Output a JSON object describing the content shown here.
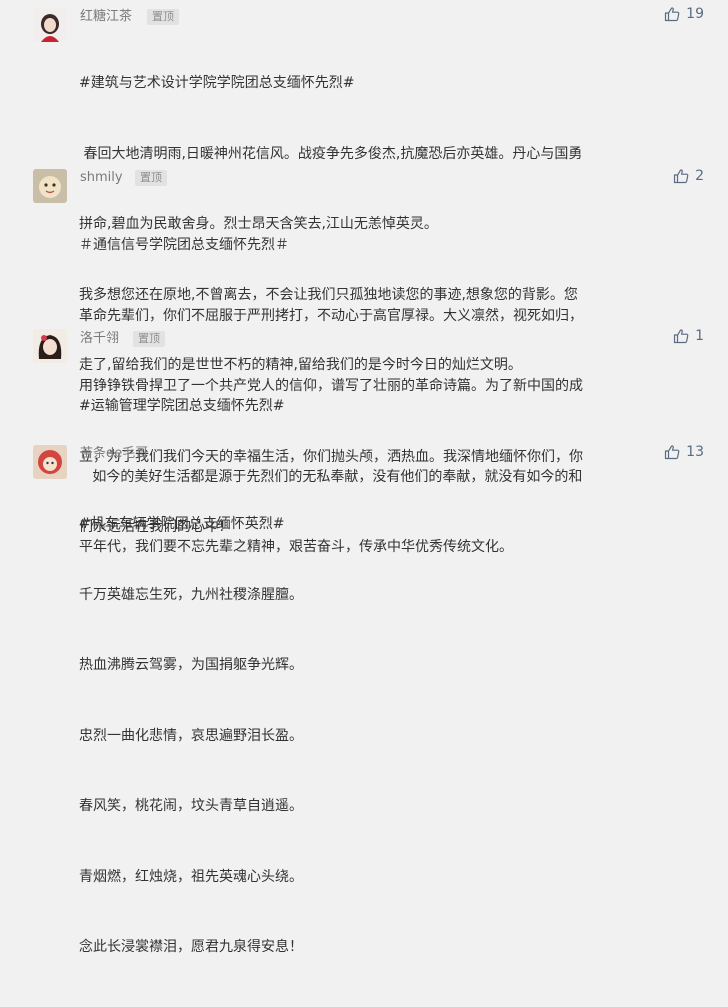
{
  "pin_label": "置顶",
  "comments": [
    {
      "user": "红糖江茶",
      "likes": "19",
      "lines": [
        "#建筑与艺术设计学院学院团总支缅怀先烈#",
        " 春回大地清明雨,日暖神州花信风。战疫争先多俊杰,抗魔恐后亦英雄。丹心与国勇",
        "拼命,碧血为民敢舍身。烈士昂天含笑去,江山无恙悼英灵。",
        "我多想您还在原地,不曾离去，不会让我们只孤独地读您的事迹,想象您的背影。您",
        "走了,留给我们的是世世不朽的精神,留给我们的是今时今日的灿烂文明。"
      ]
    },
    {
      "user": "shmily",
      "likes": "2",
      "lines": [
        "＃通信信号学院团总支缅怀先烈＃",
        "革命先辈们，你们不屈服于严刑拷打，不动心于高官厚禄。大义凛然，视死如归，",
        "用铮铮铁骨捍卫了一个共产党人的信仰，谱写了壮丽的革命诗篇。为了新中国的成",
        "立，为了我们我们今天的幸福生活，你们抛头颅，洒热血。我深情地缅怀你们，你",
        "们永远活在我们的心中!"
      ]
    },
    {
      "user": "洛千翎",
      "likes": "1",
      "lines": [
        "#运输管理学院团总支缅怀先烈#",
        "   如今的美好生活都是源于先烈们的无私奉献，没有他们的奉献，就没有如今的和",
        "平年代，我们要不忘先辈之精神，艰苦奋斗，传承中华优秀传统文化。"
      ]
    },
    {
      "user": "苗条de毛哥",
      "likes": "13",
      "lines": [
        "#机车车辆学院团总支缅怀英烈#",
        "千万英雄忘生死，九州社稷涤腥膻。",
        "热血沸腾云驾雾，为国捐躯争光辉。",
        "忠烈一曲化悲情，哀思遍野泪长盈。",
        "春风笑，桃花闹，坟头青草自逍遥。",
        "青烟燃，红烛烧，祖先英魂心头绕。",
        "念此长浸裳襟泪，愿君九泉得安息！"
      ]
    }
  ]
}
